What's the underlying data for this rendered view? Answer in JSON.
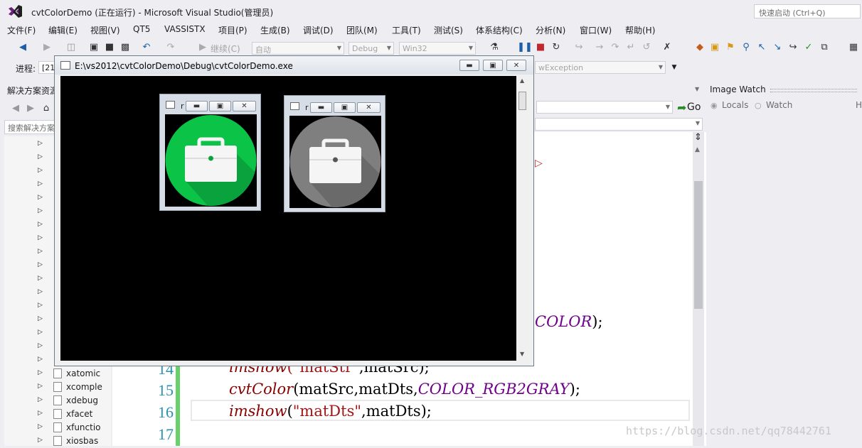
{
  "window": {
    "title": "cvtColorDemo (正在运行) - Microsoft Visual Studio(管理员)",
    "quick_launch_placeholder": "快速启动 (Ctrl+Q)"
  },
  "menu": [
    "文件(F)",
    "编辑(E)",
    "视图(V)",
    "QT5",
    "VASSISTX",
    "项目(P)",
    "生成(B)",
    "调试(D)",
    "团队(M)",
    "工具(T)",
    "测试(S)",
    "体系结构(C)",
    "分析(N)",
    "窗口(W)",
    "帮助(H)"
  ],
  "toolbar": {
    "continue_label": "继续(C)",
    "solution_config": "自动",
    "build_config": "Debug",
    "platform": "Win32",
    "process_label": "进程:",
    "process_value": "[21",
    "thread_combo": "wException"
  },
  "solution_explorer": {
    "header": "解决方案资源",
    "search_placeholder": "搜索解决方案",
    "files": [
      "xatomic",
      "xcomple",
      "xdebug",
      "xfacet",
      "xfunctio",
      "xiosbas"
    ]
  },
  "image_watch": {
    "title": "Image Watch",
    "locals_label": "Locals",
    "watch_label": "Watch",
    "h_label": "H"
  },
  "editor": {
    "go_label": "Go",
    "line_numbers": [
      "14",
      "15",
      "16",
      "17"
    ],
    "partial_macro": "COLOR",
    "partial_end": ");",
    "line14": {
      "fn": "imshow",
      "str": "\"matStr\"",
      "rest": ",matSrc);"
    },
    "line15": {
      "fn": "cvtColor",
      "args": "(matSrc,matDts,",
      "macro": "COLOR_RGB2GRAY",
      "end": ");"
    },
    "line16": {
      "fn": "imshow",
      "open": "(",
      "str": "\"matDts\"",
      "rest": ",matDts);"
    }
  },
  "console": {
    "title": "E:\\vs2012\\cvtColorDemo\\Debug\\cvtColorDemo.exe",
    "img_window_1_title": "r",
    "img_window_2_title": "r"
  },
  "colors": {
    "icon_green": "#0bc447",
    "icon_green_shadow": "#0aa23c",
    "icon_gray": "#7f7f7f",
    "icon_gray_shadow": "#6a6a6a"
  },
  "watermark": "https://blog.csdn.net/qq78442761"
}
